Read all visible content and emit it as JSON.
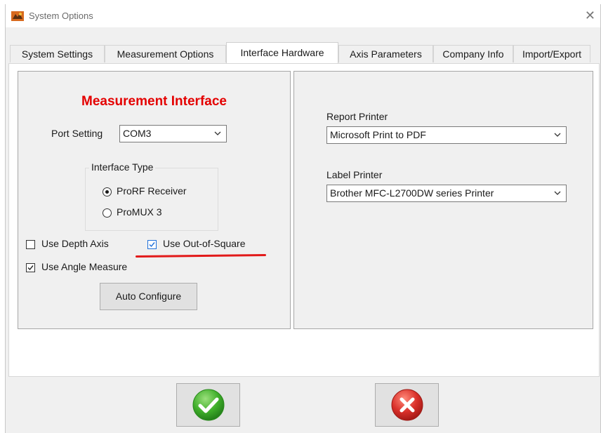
{
  "window": {
    "title": "System Options"
  },
  "tabs": [
    {
      "label": "System Settings"
    },
    {
      "label": "Measurement Options"
    },
    {
      "label": "Interface Hardware",
      "active": true
    },
    {
      "label": "Axis Parameters"
    },
    {
      "label": "Company Info"
    },
    {
      "label": "Import/Export"
    }
  ],
  "measurement_interface": {
    "title": "Measurement Interface",
    "title_color": "#e40000",
    "port_setting_label": "Port Setting",
    "port_setting_value": "COM3",
    "interface_type_label": "Interface Type",
    "radios": [
      {
        "label": "ProRF Receiver",
        "selected": true
      },
      {
        "label": "ProMUX 3",
        "selected": false
      }
    ],
    "checkboxes": {
      "depth_axis": {
        "label": "Use Depth Axis",
        "checked": false
      },
      "out_of_square": {
        "label": "Use Out-of-Square",
        "checked": true
      },
      "angle_measure": {
        "label": "Use Angle Measure",
        "checked": true
      }
    },
    "auto_configure_label": "Auto Configure"
  },
  "printers": {
    "report_label": "Report Printer",
    "report_value": "Microsoft Print to PDF",
    "label_label": "Label Printer",
    "label_value": "Brother MFC-L2700DW series Printer"
  },
  "footer": {
    "ok_icon": "green-check-icon",
    "cancel_icon": "red-x-icon",
    "ok_color": "#3fae2a",
    "cancel_color": "#d9302a"
  },
  "annotation": {
    "underline_color": "#e21a1a"
  }
}
